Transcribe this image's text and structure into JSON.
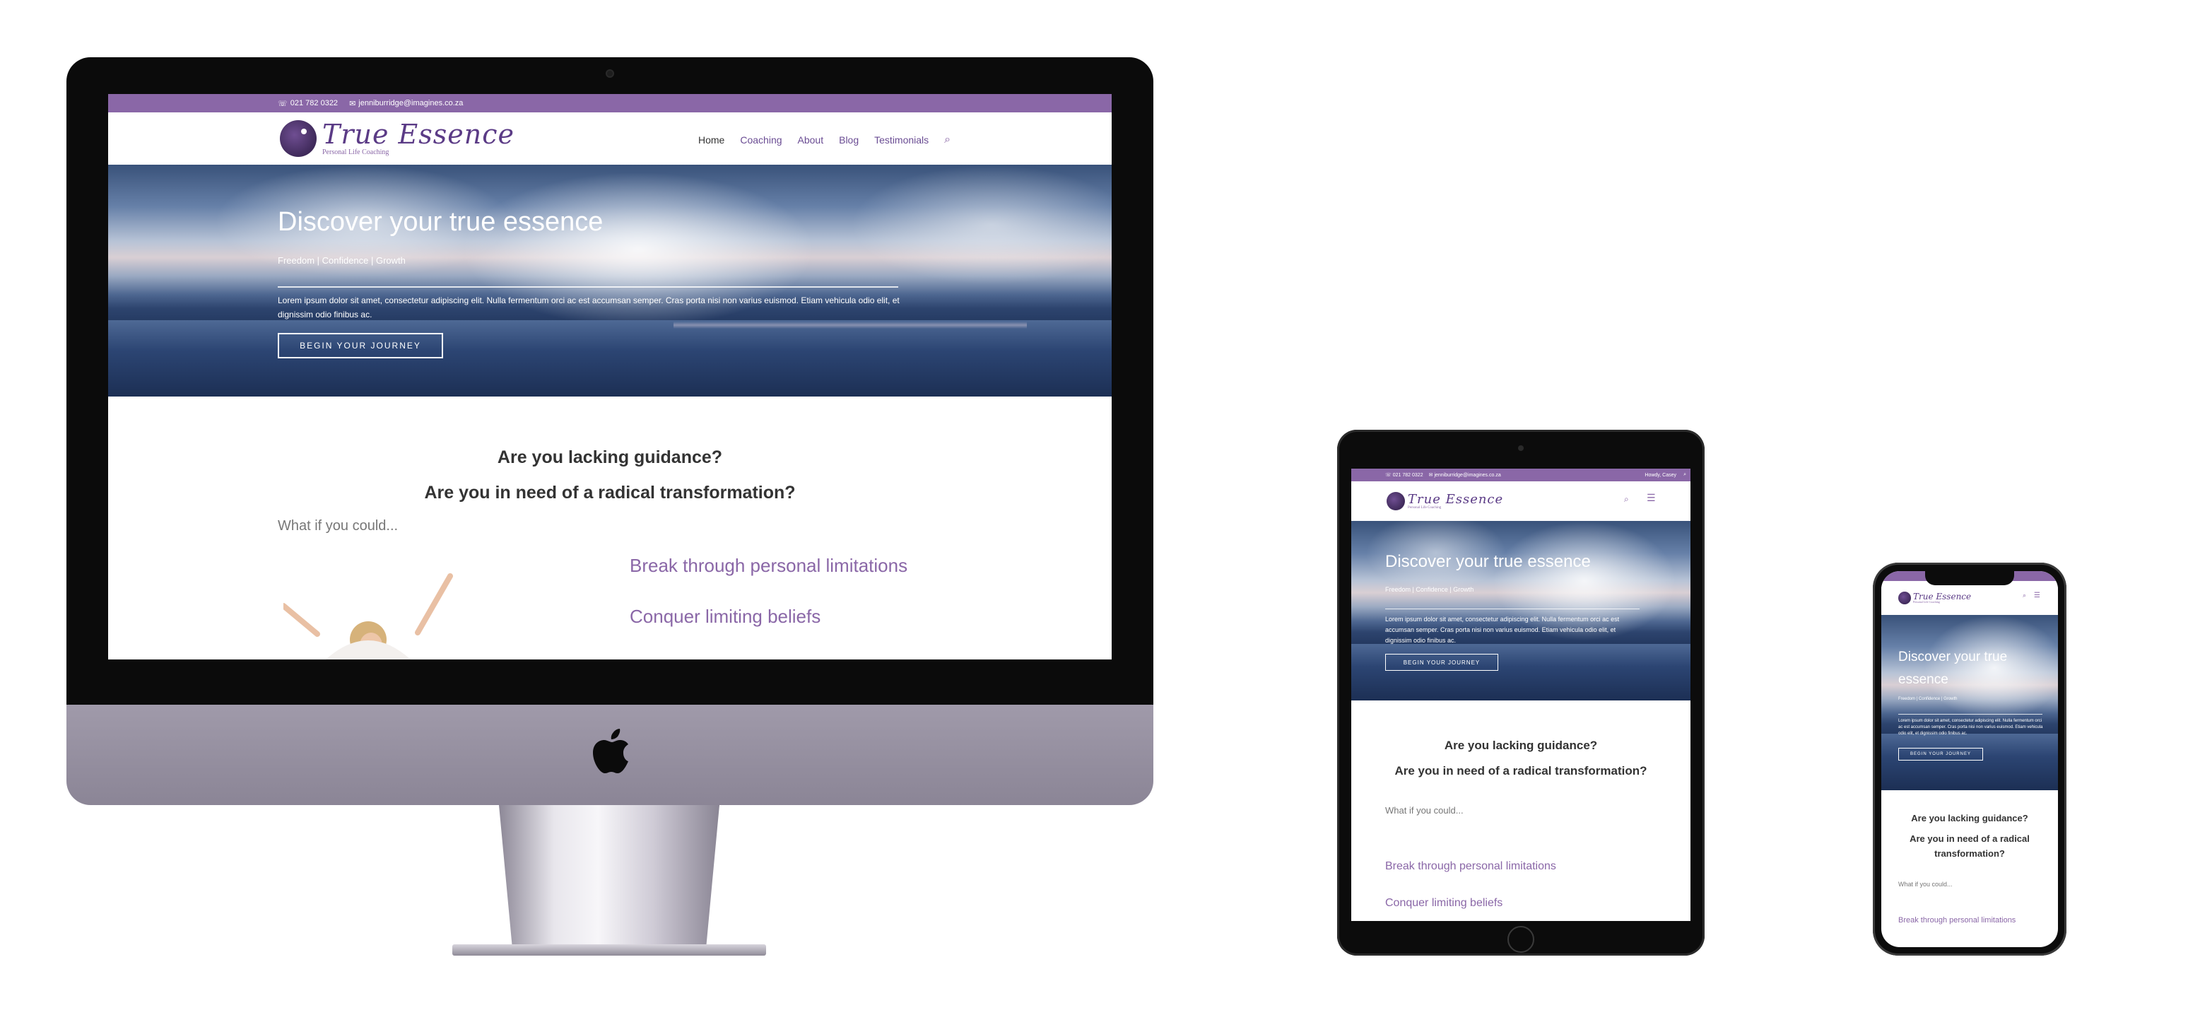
{
  "site": {
    "phone": "021 782 0322",
    "email": "jenniburridge@imagines.co.za",
    "logo_text": "True Essence",
    "logo_tagline": "Personal Life Coaching",
    "admin_greeting": "Howdy, Casey",
    "nav": [
      "Home",
      "Coaching",
      "About",
      "Blog",
      "Testimonials"
    ],
    "hero": {
      "title": "Discover your true essence",
      "subtitle": "Freedom | Confidence | Growth",
      "body": "Lorem ipsum dolor sit amet, consectetur adipiscing elit. Nulla fermentum orci ac est accumsan semper. Cras porta nisi non varius euismod. Etiam vehicula odio elit, et dignissim odio finibus ac.",
      "button": "BEGIN YOUR JOURNEY"
    },
    "content": {
      "q1": "Are you lacking guidance?",
      "q2": "Are you in need of a radical transformation?",
      "what": "What if you could...",
      "items": [
        "Break through personal limitations",
        "Conquer limiting beliefs"
      ]
    }
  },
  "colors": {
    "accent": "#8a67a7",
    "bezel": "#0b0b0b",
    "chin": "#8f8a99"
  }
}
